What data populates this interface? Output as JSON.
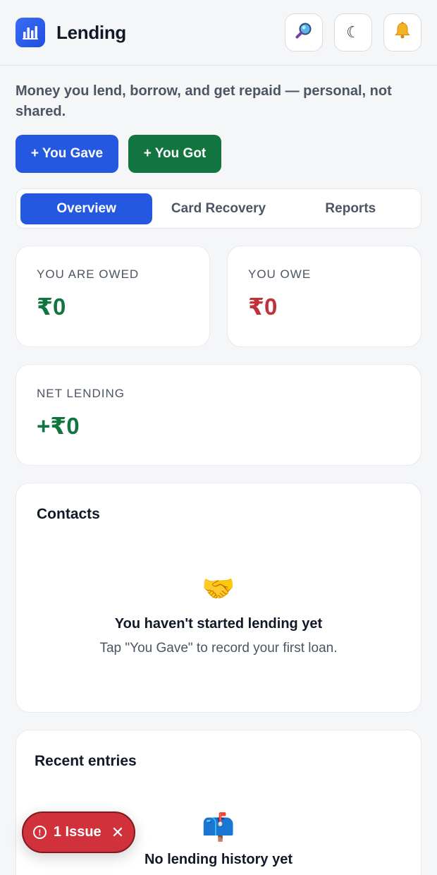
{
  "header": {
    "title": "Lending",
    "icons": [
      "search-icon",
      "moon-icon",
      "bell-icon"
    ]
  },
  "subtitle": "Money you lend, borrow, and get repaid — personal, not shared.",
  "actions": {
    "gave_label": "+ You Gave",
    "got_label": "+ You Got"
  },
  "tabs": [
    {
      "label": "Overview",
      "active": true
    },
    {
      "label": "Card Recovery",
      "active": false
    },
    {
      "label": "Reports",
      "active": false
    }
  ],
  "stats": {
    "owed_label": "YOU ARE OWED",
    "owed_value": "₹0",
    "owe_label": "YOU OWE",
    "owe_value": "₹0",
    "net_label": "NET LENDING",
    "net_value": "+₹0"
  },
  "contacts": {
    "title": "Contacts",
    "empty_title": "You haven't started lending yet",
    "empty_text": "Tap \"You Gave\" to record your first loan."
  },
  "recent": {
    "title": "Recent entries",
    "empty_title": "No lending history yet"
  },
  "issue": {
    "label": "1 Issue"
  },
  "colors": {
    "primary": "#2458e0",
    "success": "#12753f",
    "danger": "#c0313a"
  }
}
